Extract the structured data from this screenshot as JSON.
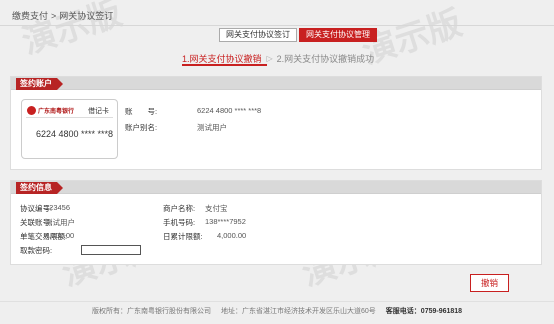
{
  "breadcrumb": {
    "parent": "缴费支付",
    "separator": ">",
    "current": "网关协议签订"
  },
  "tabs": [
    {
      "label": "网关支付协议签订",
      "active": false
    },
    {
      "label": "网关支付协议管理",
      "active": true
    }
  ],
  "steps": {
    "step1": "1.网关支付协议撤销",
    "arrow": "▷",
    "step2": "2.网关支付协议撤销成功"
  },
  "account_section": {
    "title": "签约账户",
    "card": {
      "bank_name": "广东南粤银行",
      "card_type": "借记卡",
      "number": "6224 4800 **** ***8"
    },
    "account_label": "账　　号:",
    "account_value": "6224 4800 **** ***8",
    "alias_label": "账户别名:",
    "alias_value": "测试用户"
  },
  "info_section": {
    "title": "签约信息",
    "protocol_no_label": "协议编号:",
    "protocol_no_value": "123456",
    "merchant_label": "商户名称:",
    "merchant_value": "支付宝",
    "alias_label": "关联账号:",
    "alias_value": "测试用户",
    "phone_label": "手机号码:",
    "phone_value": "138****7952",
    "single_limit_label": "单笔交易限额:",
    "single_limit_value": "4,000.00",
    "daily_limit_label": "日累计限额:",
    "daily_limit_value": "4,000.00",
    "password_label": "取款密码:"
  },
  "cancel_button": "撤销",
  "footer": {
    "copyright": "版权所有：广东南粤银行股份有限公司",
    "address": "地址：广东省湛江市经济技术开发区乐山大道60号",
    "hotline_label": "客服电话：",
    "hotline": "0759-961818"
  },
  "watermark": "演示版",
  "colors": {
    "accent": "#c82020",
    "page_bg": "#efefef",
    "panel_head": "#d9d9d9"
  }
}
